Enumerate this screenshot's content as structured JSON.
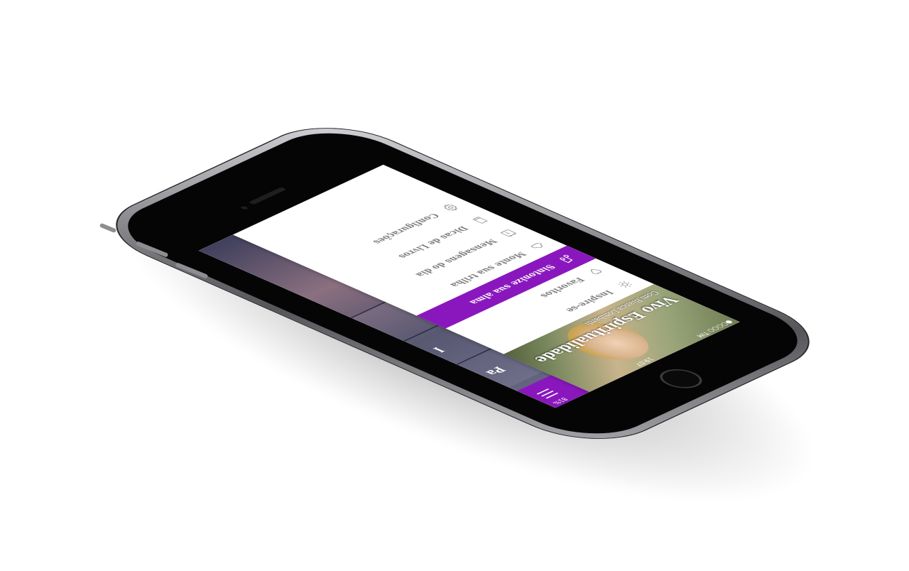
{
  "status_bar": {
    "carrier": "●○○○○ TIM",
    "time": "19:07",
    "battery": "81%"
  },
  "header": {
    "title": "Vivo Espiritualidade",
    "subtitle": "Com Bianca Lombardi"
  },
  "menu": {
    "items": [
      {
        "label": "Inspire-se",
        "icon": "sun-icon",
        "active": false
      },
      {
        "label": "Favoritos",
        "icon": "heart-icon",
        "active": false
      },
      {
        "label": "Sintonize sua alma",
        "icon": "music-note-icon",
        "active": true
      },
      {
        "label": "Monte sua trilha",
        "icon": "cloud-icon",
        "active": false
      },
      {
        "label": "Mensagens do dia",
        "icon": "calendar-icon",
        "active": false
      },
      {
        "label": "Dicas de Livros",
        "icon": "book-icon",
        "active": false
      },
      {
        "label": "Configurações",
        "icon": "gear-icon",
        "active": false
      }
    ]
  },
  "content": {
    "labels": [
      "Pa",
      "I"
    ]
  },
  "colors": {
    "accent": "#8a17bd",
    "menu_text": "#7a7a7a",
    "drawer_bg": "#ffffff"
  }
}
